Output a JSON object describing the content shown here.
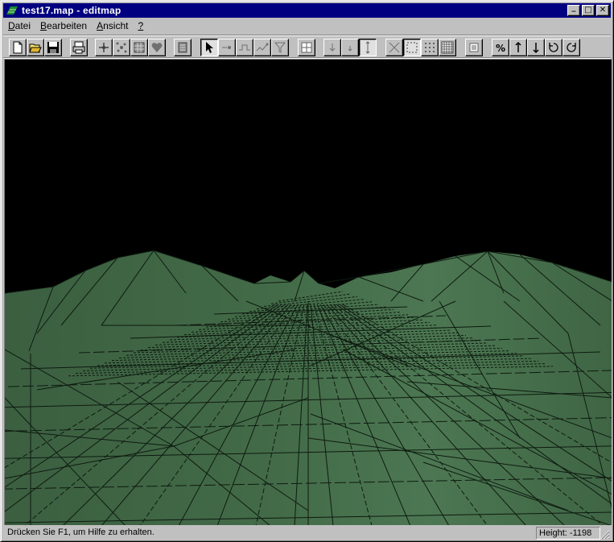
{
  "window": {
    "title": "test17.map - editmap",
    "controls": {
      "minimize": "_",
      "maximize": "□",
      "close": "✕"
    }
  },
  "menu": {
    "items": [
      {
        "first": "D",
        "rest": "atei"
      },
      {
        "first": "B",
        "rest": "earbeiten"
      },
      {
        "first": "A",
        "rest": "nsicht"
      },
      {
        "first": "?",
        "rest": ""
      }
    ]
  },
  "toolbar": {
    "buttons": [
      {
        "icon": "new-document-icon"
      },
      {
        "icon": "open-folder-icon"
      },
      {
        "icon": "save-disk-icon"
      },
      {
        "icon": "print-icon"
      },
      {
        "icon": "height-add-icon"
      },
      {
        "icon": "height-scatter-icon"
      },
      {
        "icon": "texture-icon"
      },
      {
        "icon": "heart-object-icon"
      },
      {
        "icon": "page-icon"
      },
      {
        "icon": "select-arrow-icon",
        "pressed": true
      },
      {
        "icon": "point-tool-icon"
      },
      {
        "icon": "line-tool-icon"
      },
      {
        "icon": "path-tool-icon"
      },
      {
        "icon": "filter-tool-icon"
      },
      {
        "icon": "grid-quad-icon"
      },
      {
        "icon": "lower-icon"
      },
      {
        "icon": "small-lower-icon"
      },
      {
        "icon": "vertical-split-icon",
        "pressed": true
      },
      {
        "icon": "cross-view-icon"
      },
      {
        "icon": "frame-view-icon",
        "pressed": true
      },
      {
        "icon": "dots-grid-icon"
      },
      {
        "icon": "fine-grid-icon"
      },
      {
        "icon": "layers-icon"
      },
      {
        "icon": "percent-icon"
      },
      {
        "icon": "arrow-up-icon"
      },
      {
        "icon": "arrow-down-icon"
      },
      {
        "icon": "rotate-ccw-icon"
      },
      {
        "icon": "rotate-cw-icon"
      }
    ]
  },
  "viewport": {
    "sky_color": "#000000",
    "terrain_color": "#436b48",
    "wireframe_color": "#0e1a10"
  },
  "status": {
    "message": "Drücken Sie F1, um Hilfe zu erhalten.",
    "height": "Height: -1198"
  },
  "colors": {
    "titlebar": "#000080",
    "face": "#c0c0c0"
  }
}
